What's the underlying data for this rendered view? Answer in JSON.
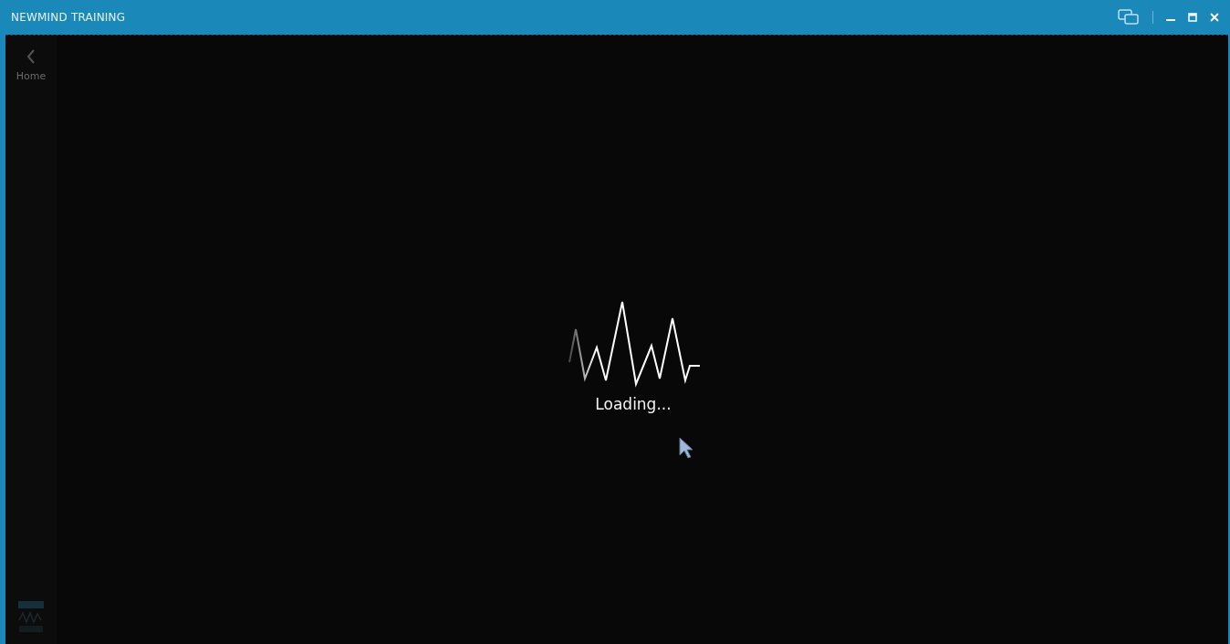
{
  "window": {
    "title": "NEWMIND TRAINING"
  },
  "sidebar": {
    "back_label": "Home"
  },
  "loader": {
    "text": "Loading..."
  }
}
